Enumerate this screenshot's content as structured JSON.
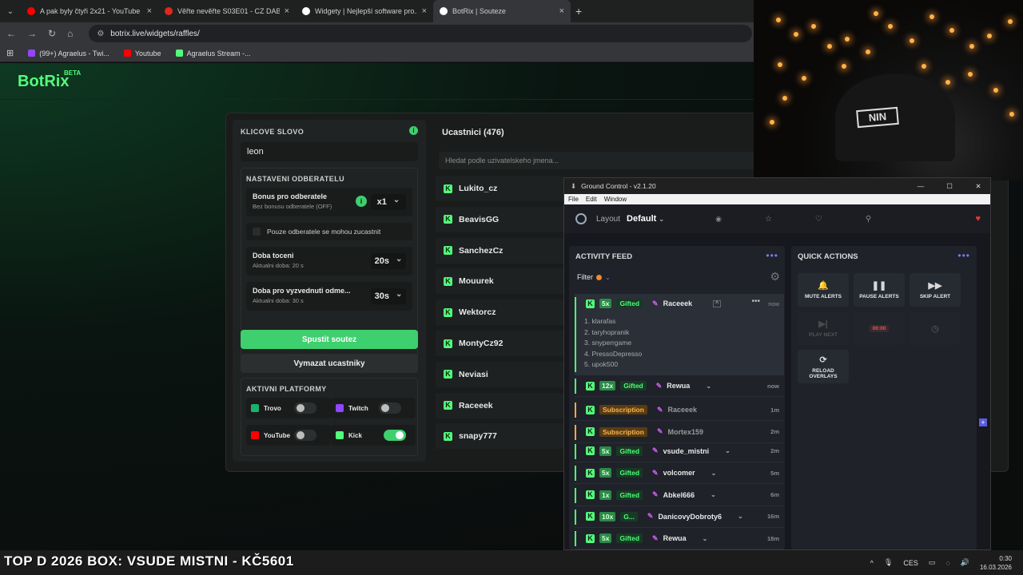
{
  "browser": {
    "tabs": [
      {
        "title": "A pak byly čtyři 2x21 - YouTube",
        "favcolor": "#ff0000",
        "active": false
      },
      {
        "title": "Věřte nevěřte S03E01 - CZ DABING",
        "favcolor": "#e0281e",
        "active": false
      },
      {
        "title": "Widgety | Nejlepší software pro...",
        "favcolor": "#ffffff",
        "active": false
      },
      {
        "title": "BotRix | Souteze",
        "favcolor": "#ffffff",
        "active": true
      }
    ],
    "url": "botrix.live/widgets/raffles/",
    "bookmarks": [
      {
        "label": "(99+) Agraelus - Twi...",
        "color": "#9146ff"
      },
      {
        "label": "Youtube",
        "color": "#ff0000"
      },
      {
        "label": "Agraelus Stream -...",
        "color": "#53fc7a"
      }
    ]
  },
  "site": {
    "logo": "BotRix",
    "logo_badge": "BETA"
  },
  "raffle": {
    "keyword_label": "KLICOVE SLOVO",
    "keyword_value": "leon",
    "subscriber_settings_label": "NASTAVENI ODBERATELU",
    "bonus_title": "Bonus pro odberatele",
    "bonus_sub": "Bez bonusu odberatele (OFF)",
    "bonus_value": "x1",
    "only_subs_label": "Pouze odberatele se mohou zucastnit",
    "spin_title": "Doba toceni",
    "spin_sub": "Aktualni doba: 20 s",
    "spin_value": "20s",
    "pickup_title": "Doba pro vyzvednuti odme...",
    "pickup_sub": "Aktualni doba: 30 s",
    "pickup_value": "30s",
    "start_button": "Spustit soutez",
    "clear_button": "Vymazat ucastniky",
    "platforms_label": "AKTIVNI PLATFORMY",
    "platforms": [
      {
        "name": "Trovo",
        "color": "#1bb36a",
        "on": false
      },
      {
        "name": "Twitch",
        "color": "#9146ff",
        "on": false
      },
      {
        "name": "YouTube",
        "color": "#ff0000",
        "on": false
      },
      {
        "name": "Kick",
        "color": "#53fc7a",
        "on": true
      }
    ],
    "participants_title": "Ucastnici (476)",
    "search_placeholder": "Hledat podle uzivatelskeho jmena...",
    "participants": [
      "Lukito_cz",
      "BeavisGG",
      "SanchezCz",
      "Mouurek",
      "Wektorcz",
      "MontyCz92",
      "Neviasi",
      "Raceeek",
      "snapy777"
    ]
  },
  "ground_control": {
    "window_title": "Ground Control - v2.1.20",
    "menu": [
      "File",
      "Edit",
      "Window"
    ],
    "layout_label": "Layout",
    "layout_value": "Default",
    "activity_title": "ACTIVITY FEED",
    "filter_label": "Filter",
    "quick_title": "QUICK ACTIONS",
    "expanded": {
      "count": "5x",
      "type": "Gifted",
      "user": "Raceeek",
      "time": "now",
      "recipients": [
        "1. klarafas",
        "2. taryhopranik",
        "3. snyperrgame",
        "4. PressoDepresso",
        "5. upok500"
      ]
    },
    "events": [
      {
        "count": "12x",
        "type": "Gifted",
        "user": "Rewua",
        "time": "now",
        "sub": false,
        "chev": true
      },
      {
        "count": "",
        "type": "Subscription",
        "user": "Raceeek",
        "time": "1m",
        "sub": true,
        "chev": false
      },
      {
        "count": "",
        "type": "Subscription",
        "user": "Mortex159",
        "time": "2m",
        "sub": true,
        "chev": false
      },
      {
        "count": "5x",
        "type": "Gifted",
        "user": "vsude_mistni",
        "time": "2m",
        "sub": false,
        "chev": true
      },
      {
        "count": "5x",
        "type": "Gifted",
        "user": "volcomer",
        "time": "5m",
        "sub": false,
        "chev": true
      },
      {
        "count": "1x",
        "type": "Gifted",
        "user": "Abkel666",
        "time": "6m",
        "sub": false,
        "chev": true
      },
      {
        "count": "10x",
        "type": "G...",
        "user": "DanicovyDobroty6",
        "time": "16m",
        "sub": false,
        "chev": true
      },
      {
        "count": "5x",
        "type": "Gifted",
        "user": "Rewua",
        "time": "18m",
        "sub": false,
        "chev": true
      }
    ],
    "quick_actions": [
      {
        "label": "MUTE ALERTS",
        "icon": "bell-icon",
        "glyph": "🔔",
        "disabled": false
      },
      {
        "label": "PAUSE ALERTS",
        "icon": "pause-icon",
        "glyph": "❚❚",
        "disabled": false
      },
      {
        "label": "SKIP ALERT",
        "icon": "skip-icon",
        "glyph": "▶▶",
        "disabled": false
      },
      {
        "label": "PLAY NEXT",
        "icon": "play-next-icon",
        "glyph": "▶|",
        "disabled": true
      },
      {
        "label": "00:00",
        "icon": "timer-icon",
        "glyph": "",
        "disabled": true
      },
      {
        "label": "",
        "icon": "clock-icon",
        "glyph": "◷",
        "disabled": true
      },
      {
        "label": "RELOAD OVERLAYS",
        "icon": "reload-icon",
        "glyph": "⟳",
        "disabled": false
      }
    ]
  },
  "taskbar": {
    "ticker": "TOP D 2026 BOX: VSUDE MISTNI - KČ5601",
    "lang": "CES",
    "time": "0:30",
    "date": "16.03.2026"
  }
}
